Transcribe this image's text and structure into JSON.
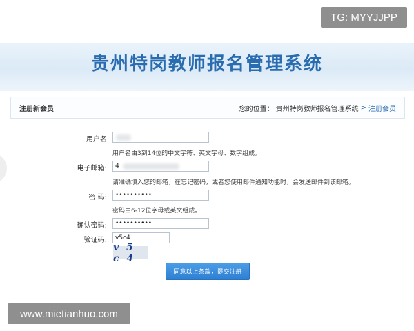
{
  "overlay": {
    "tg_badge": "TG: MYYJJPP",
    "site_watermark": "www.mietianhuo.com"
  },
  "header": {
    "title": "贵州特岗教师报名管理系统"
  },
  "navbar": {
    "section_title": "注册新会员",
    "breadcrumb_prefix": "您的位置：",
    "breadcrumb_home": "贵州特岗教师报名管理系统",
    "breadcrumb_sep": ">",
    "breadcrumb_current": "注册会员"
  },
  "form": {
    "username": {
      "label": "用户名",
      "hint": "用户名由3到14位的中文字符、英文字母、数字组成。"
    },
    "email": {
      "label": "电子邮箱:",
      "value_visible": "4",
      "hint": "请准确填入您的邮箱，在忘记密码，或者您使用邮件通知功能时，会发送邮件到该邮箱。"
    },
    "password": {
      "label": "密 码:",
      "value": "••••••••••",
      "hint": "密码由6-12位字母或英文组成。"
    },
    "confirm_password": {
      "label": "确认密码:",
      "value": "••••••••••"
    },
    "captcha": {
      "label": "验证码:",
      "value": "v5c4",
      "image_text": "v 5 c 4"
    },
    "submit_label": "同意以上条款，提交注册"
  }
}
